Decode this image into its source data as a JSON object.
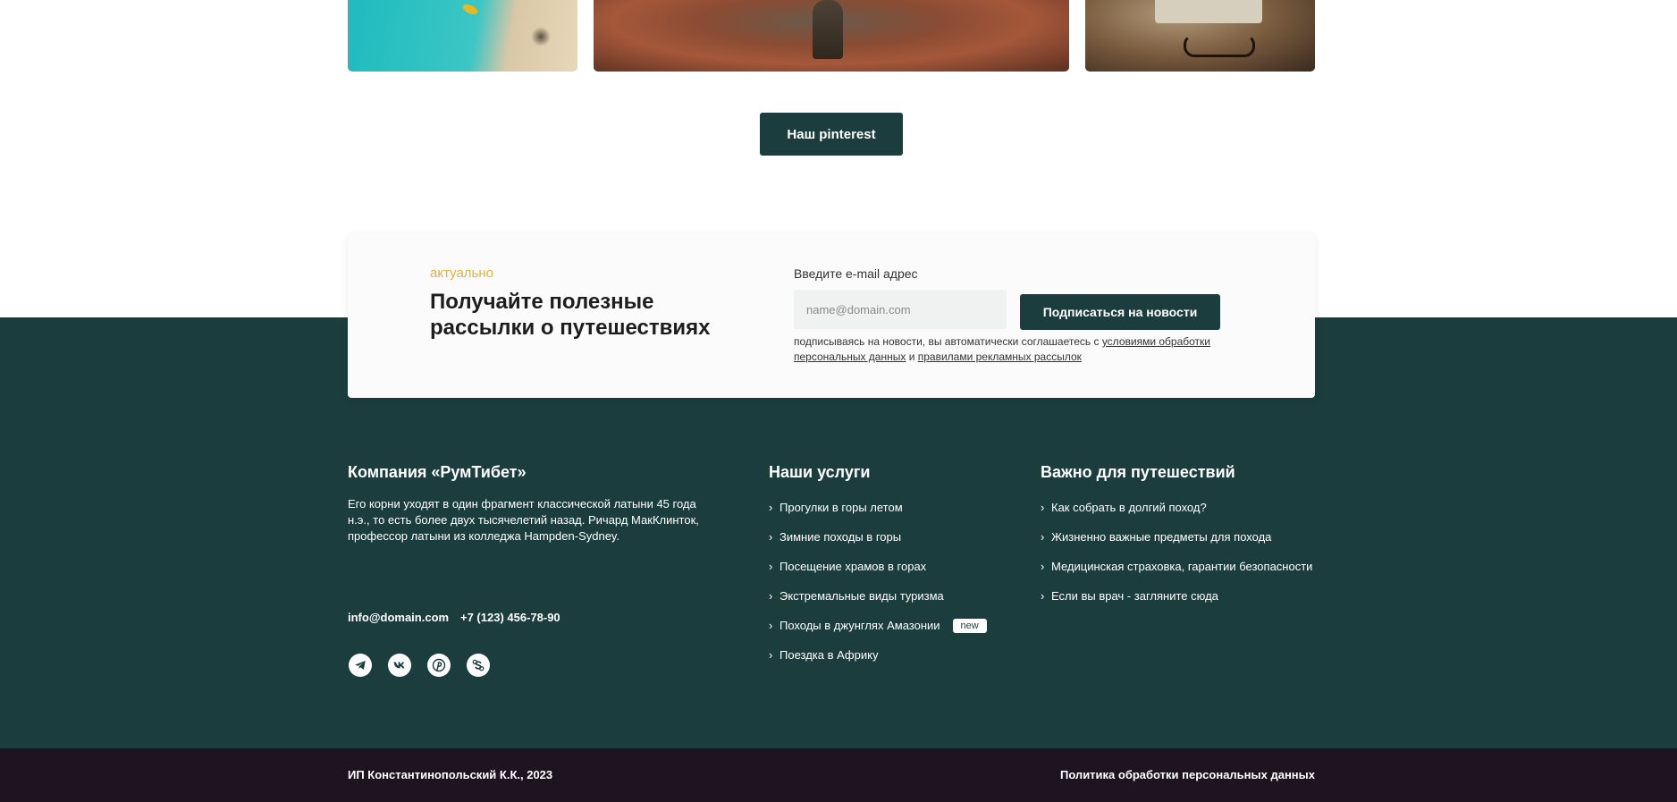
{
  "gallery": {
    "button_label": "Наш pinterest"
  },
  "newsletter": {
    "tag": "актуально",
    "title": "Получайте полезные рассылки о путешествиях",
    "email_label": "Введите e-mail адрес",
    "email_placeholder": "name@domain.com",
    "subscribe_label": "Подписаться на новости",
    "note_prefix": "подписываясь на новости, вы автоматически соглашаетесь с ",
    "note_link1": "условиями обработки персональных данных",
    "note_and": " и ",
    "note_link2": "правилами рекламных рассылок"
  },
  "company": {
    "title": "Компания «РумТибет»",
    "text": "Его корни уходят в один фрагмент классической латыни 45 года н.э., то есть более двух тысячелетий назад. Ричард МакКлинток, профессор латыни из колледжа Hampden-Sydney.",
    "email": "info@domain.com",
    "phone": "+7 (123) 456-78-90",
    "socials": [
      "telegram-icon",
      "vk-icon",
      "pinterest-icon",
      "skype-icon"
    ]
  },
  "services": {
    "title": "Наши услуги",
    "items": [
      {
        "label": "Прогулки в горы летом"
      },
      {
        "label": "Зимние походы в горы"
      },
      {
        "label": "Посещение храмов в горах"
      },
      {
        "label": "Экстремальные виды туризма"
      },
      {
        "label": "Походы в джунглях Амазонии",
        "badge": "new"
      },
      {
        "label": "Поездка в Африку"
      }
    ]
  },
  "important": {
    "title": "Важно для путешествий",
    "items": [
      {
        "label": "Как собрать в долгий поход?"
      },
      {
        "label": "Жизненно важные предметы для похода"
      },
      {
        "label": "Медицинская страховка, гарантии безопасности"
      },
      {
        "label": "Если вы врач - загляните сюда"
      }
    ]
  },
  "bottom": {
    "copyright": "ИП Константинопольский К.К., 2023",
    "policy": "Политика обработки персональных данных"
  },
  "colors": {
    "primary": "#1c3d3d",
    "accent": "#e2b43a",
    "bottom_bar": "#1d1420"
  }
}
